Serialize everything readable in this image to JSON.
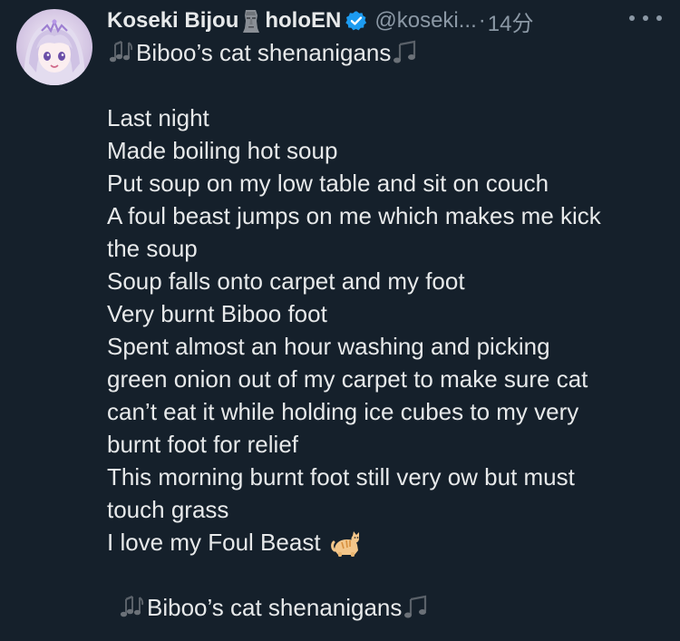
{
  "tweet": {
    "display_name": "Koseki Bijou",
    "org_name": "holoEN",
    "handle": "@koseki...",
    "separator": "·",
    "time": "14分",
    "title_line": "Biboo’s cat shenanigans",
    "body_lines": [
      "Last night",
      "Made boiling hot soup",
      "Put soup on my low table and sit on couch",
      "A foul beast jumps on me which makes me kick",
      "the soup",
      "Soup falls onto carpet and my foot",
      "Very burnt Biboo foot",
      "Spent almost an hour washing and picking",
      "green onion out of my carpet to make sure cat",
      "can’t eat it while holding ice cubes to my very",
      "burnt foot for relief",
      "This morning burnt foot still very ow but must",
      "touch grass"
    ],
    "last_line": "I love my Foul Beast",
    "closing_line": "Biboo’s cat shenanigans"
  },
  "icons": {
    "verified": "verified-badge-icon",
    "moai": "moai-icon",
    "music_left": "multiple-notes-icon",
    "music_right": "musical-note-icon",
    "cat": "cat-icon",
    "more": "more-icon"
  },
  "colors": {
    "background": "#15202b",
    "text": "#e7e9ea",
    "secondary": "#8b98a5",
    "verified": "#1d9bf0"
  }
}
